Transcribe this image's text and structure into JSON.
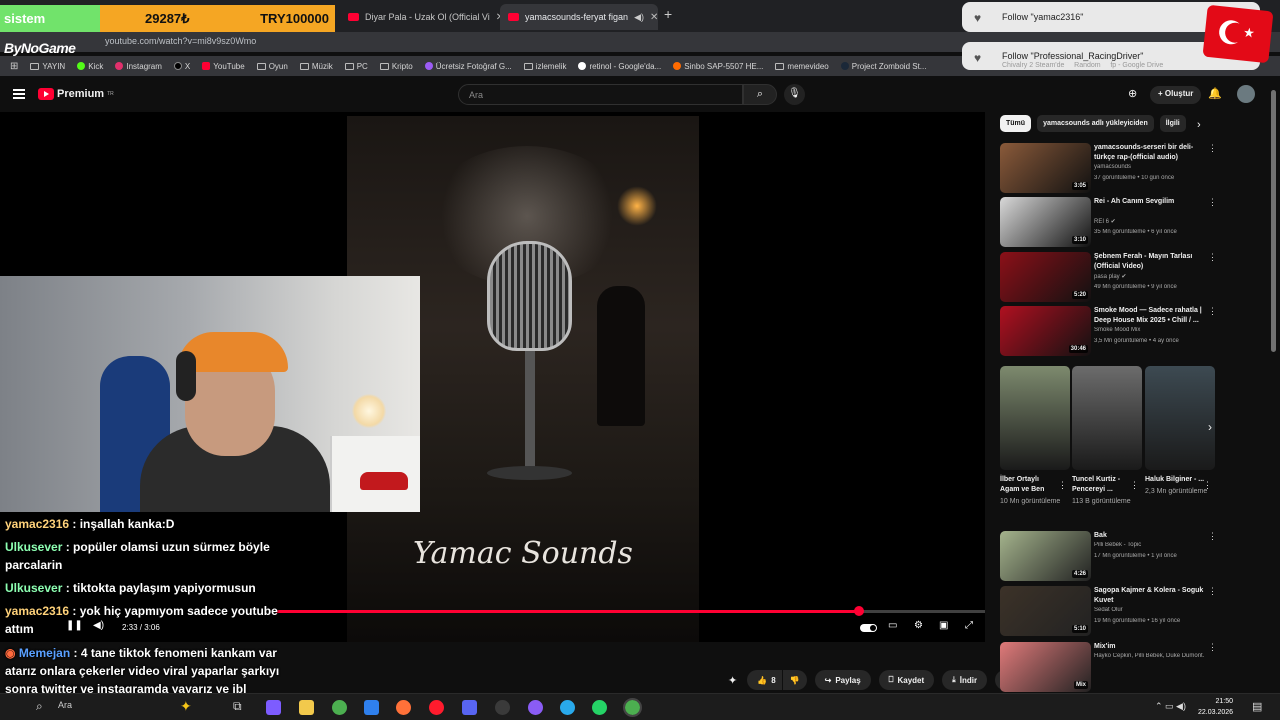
{
  "overlay": {
    "banner_label": "sistem",
    "banner_count": "29287₺",
    "banner_goal": "TRY100000",
    "channel_logo": "ByNoGame"
  },
  "browser": {
    "tabs": [
      {
        "title": "Diyar Pala - Uzak Ol (Official Vi",
        "active": false
      },
      {
        "title": "yamacsounds-feryat figan",
        "active": true
      }
    ],
    "new_tab": "+",
    "url": "youtube.com/watch?v=mi8v9sz0Wmo",
    "bookmarks": [
      "YAYIN",
      "Kick",
      "Instagram",
      "X",
      "YouTube",
      "Oyun",
      "Müzik",
      "PC",
      "Kripto",
      "Ücretsiz Fotoğraf G...",
      "izlemelik",
      "retinol - Google'da...",
      "Sinbo SAP-5507 HE...",
      "memevideo",
      "Project Zomboid St..."
    ]
  },
  "notifications": [
    {
      "text": "Follow \"yamac2316\""
    },
    {
      "text": "Follow \"Professional_RacingDriver\""
    }
  ],
  "notification_tail": [
    "Chivalry 2 Steam'de",
    "Random",
    "fp - Google Drive"
  ],
  "youtube": {
    "logo_text": "Premium",
    "logo_region": "TR",
    "search_placeholder": "Ara",
    "create_label": "Oluştur"
  },
  "video": {
    "brand_text": "Yamac Sounds",
    "time": "2:33 / 3:06",
    "progress": 0.8222
  },
  "actions": {
    "likes": "8",
    "share": "Paylaş",
    "save": "Kaydet",
    "download": "İndir"
  },
  "chat": [
    {
      "user": "yamac2316",
      "text": " : inşallah kanka:D",
      "cls": "u1"
    },
    {
      "user": "Ulkusever",
      "text": " : popüler olamsi uzun sürmez böyle parcalarin",
      "cls": "u2"
    },
    {
      "user": "Ulkusever",
      "text": " : tiktokta paylaşım yapiyormusun",
      "cls": "u2"
    },
    {
      "user": "yamac2316",
      "text": " : yok hiç yapmıyom sadece youtube attım",
      "cls": "u1"
    },
    {
      "user": "Memejan",
      "text": " : 4 tane tiktok fenomeni kankam var atarız onlara çekerler video viral yaparlar şarkıyı sonra twitter ve instagramda yayarız ye ibl tilaver olursun",
      "cls": "u3"
    }
  ],
  "sidebar": {
    "chips": [
      "Tümü",
      "yamacsounds adlı yükleyiciden",
      "İlgili"
    ],
    "recs": [
      {
        "title": "yamacsounds-serseri bir deli-türkçe rap-(official audio)",
        "channel": "yamacsounds",
        "meta": "37 görüntüleme • 10 gün önce",
        "duration": "3:05",
        "color": "#8a5a3a"
      },
      {
        "title": "Rei - Ah Canım Sevgilim",
        "channel": "REI 6 ✔",
        "meta": "35 Mn görüntüleme • 6 yıl önce",
        "duration": "3:10",
        "color": "#d9d9d9"
      },
      {
        "title": "Şebnem Ferah - Mayın Tarlası (Official Video)",
        "channel": "pasa play ✔",
        "meta": "49 Mn görüntüleme • 9 yıl önce",
        "duration": "5:20",
        "color": "#8c1018"
      },
      {
        "title": "Smoke Mood — Sadece rahatla | Deep House Mix 2025 • Chill / ...",
        "channel": "Smoke Mood Mix",
        "meta": "3,5 Mn görüntüleme • 4 ay önce",
        "duration": "30:46",
        "color": "#b01020"
      }
    ],
    "shorts": [
      {
        "title": "İlber Ortaylı Agam ve Ben",
        "views": "10 Mn görüntüleme",
        "color": "#7d8a6e"
      },
      {
        "title": "Tuncel Kurtiz - Pencereyi ...",
        "views": "113 B görüntüleme",
        "color": "#6c6c6c"
      },
      {
        "title": "Haluk Bilginer - ...",
        "views": "2,3 Mn görüntüleme",
        "color": "#3d4a52"
      }
    ],
    "recs2": [
      {
        "title": "Bak",
        "channel": "Pilli Bebek - Topic",
        "meta": "17 Mn görüntüleme • 1 yıl önce",
        "duration": "4:26",
        "color": "#a4b38c"
      },
      {
        "title": "Sagopa Kajmer & Kolera - Soguk Kuvet",
        "channel": "Sedat Olur",
        "meta": "19 Mn görüntüleme • 16 yıl önce",
        "duration": "5:10",
        "color": "#3c3228"
      },
      {
        "title": "Mix'im",
        "channel": "Hayko Cepkin, Pilli Bebek, Duke Dumont...",
        "meta": "",
        "duration": "Mix",
        "color": "#e07a7a"
      }
    ]
  },
  "taskbar": {
    "search": "Ara",
    "time": "21:50",
    "date": "22.03.2026"
  }
}
